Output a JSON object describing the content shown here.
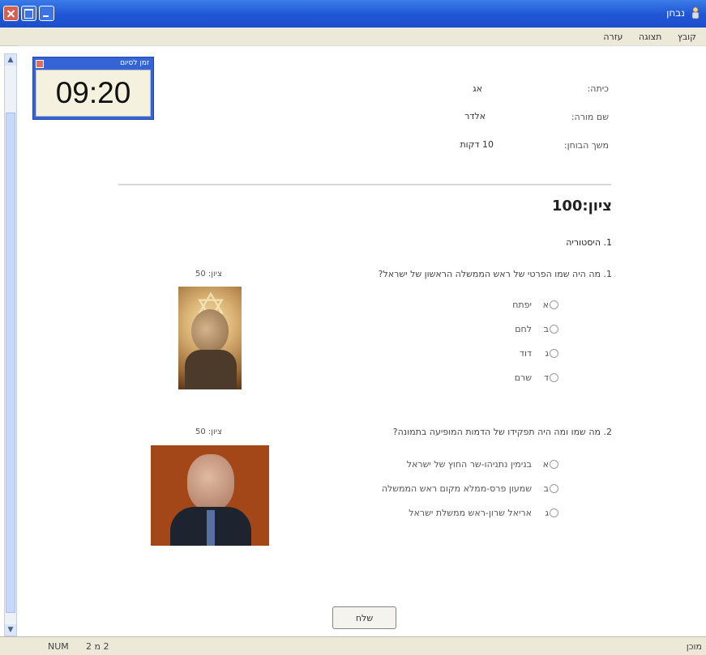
{
  "app": {
    "title": "נבחן",
    "accent_color": "#2458d6"
  },
  "menu": {
    "items": [
      "קובץ",
      "תצוגה",
      "עזרה"
    ]
  },
  "timer": {
    "label": "זמן לסיום",
    "value": "09:20"
  },
  "info": {
    "class_label": "כיתה:",
    "class_value": "אג",
    "teacher_label": "שם מורה:",
    "teacher_value": "אלדר",
    "duration_label": "משך הבוחן:",
    "duration_value": "10 דקות"
  },
  "exam": {
    "grade_text": "ציון:100",
    "section_title": "1. היסטוריה",
    "questions": [
      {
        "text": "1. מה היה שמו הפרטי של ראש הממשלה הראשון של ישראל?",
        "score": "ציון: 50",
        "options": [
          {
            "letter": "א",
            "text": "יפתח"
          },
          {
            "letter": "ב",
            "text": "לחם"
          },
          {
            "letter": "ג",
            "text": "דוד"
          },
          {
            "letter": "ד",
            "text": "שרם"
          }
        ]
      },
      {
        "text": "2. מה שמו ומה היה תפקידו של הדמות המופיעה בתמונה?",
        "score": "ציון: 50",
        "options": [
          {
            "letter": "א",
            "text": "בנימין נתניהו-שר החוץ של ישראל"
          },
          {
            "letter": "ב",
            "text": "שמעון פרס-ממלא מקום ראש הממשלה"
          },
          {
            "letter": "ג",
            "text": "אריאל שרון-ראש ממשלת ישראל"
          }
        ]
      }
    ]
  },
  "actions": {
    "send_label": "שלח"
  },
  "status": {
    "num": "NUM",
    "page": "2 מ 2",
    "ready": "מוכן"
  }
}
